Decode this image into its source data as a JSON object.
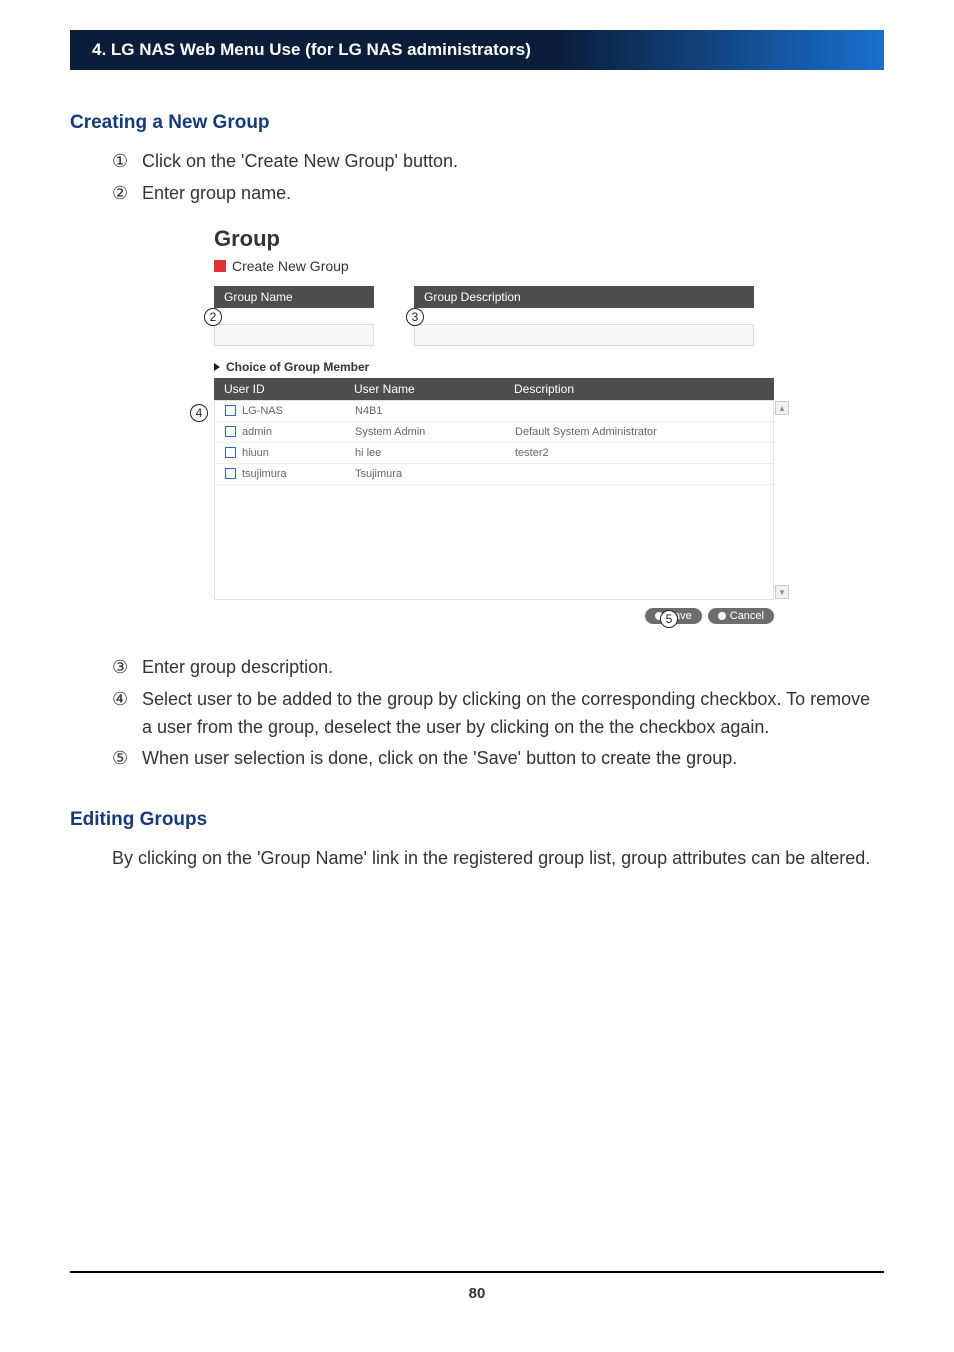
{
  "header": "4. LG NAS Web Menu Use (for LG NAS administrators)",
  "section1": {
    "title": "Creating a New Group",
    "steps_a": [
      {
        "num": "①",
        "text": "Click on the 'Create New Group' button."
      },
      {
        "num": "②",
        "text": "Enter group name."
      }
    ],
    "steps_b": [
      {
        "num": "③",
        "text": "Enter group description."
      },
      {
        "num": "④",
        "text": "Select user to be added to the group by clicking on the corresponding checkbox. To remove a user from the group, deselect the user by clicking on the the checkbox again."
      },
      {
        "num": "⑤",
        "text": "When user selection is done, click on the 'Save' button to create the group."
      }
    ]
  },
  "section2": {
    "title": "Editing Groups",
    "para": "By clicking on the 'Group Name' link in the registered group list, group attributes can be altered."
  },
  "screenshot": {
    "title": "Group",
    "subtitle": "Create New Group",
    "field1_label": "Group Name",
    "field2_label": "Group Description",
    "circ2": "2",
    "circ3": "3",
    "circ4": "4",
    "circ5": "5",
    "choice_label": "Choice of Group Member",
    "cols": {
      "id": "User ID",
      "name": "User Name",
      "desc": "Description"
    },
    "rows": [
      {
        "id": "LG-NAS",
        "name": "N4B1",
        "desc": ""
      },
      {
        "id": "admin",
        "name": "System Admin",
        "desc": "Default System Administrator"
      },
      {
        "id": "hiuun",
        "name": "hi lee",
        "desc": "tester2"
      },
      {
        "id": "tsujimura",
        "name": "Tsujimura",
        "desc": ""
      }
    ],
    "save_label": "Save",
    "cancel_label": "Cancel"
  },
  "page_number": "80"
}
